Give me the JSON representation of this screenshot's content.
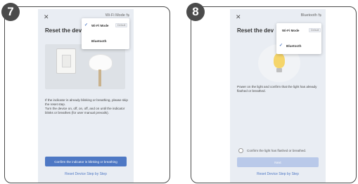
{
  "step_left": {
    "number": "7",
    "close_icon": "close-icon",
    "topright_label": "Wi-Fi Mode ⇆",
    "title": "Reset the dev",
    "dropdown": {
      "items": [
        {
          "label": "Wi-Fi Mode",
          "tag": "Default",
          "selected": true
        },
        {
          "label": "Bluetooth",
          "tag": "",
          "selected": false
        }
      ]
    },
    "description": "If the indicator is already blinking or breathing, please skip the reset step.\nTurn the device on, off, on, off, and on until the indicator blinks or breathes (for user manual prevails).",
    "confirm_button": "Confirm the indicator is blinking or breathing",
    "reset_link": "Reset Device Step by Step"
  },
  "step_right": {
    "number": "8",
    "close_icon": "close-icon",
    "topright_label": "Bluetooth ⇆",
    "title": "Reset the dev",
    "dropdown": {
      "items": [
        {
          "label": "Wi-Fi Mode",
          "tag": "Default",
          "selected": false
        },
        {
          "label": "Bluetooth",
          "tag": "",
          "selected": true
        }
      ]
    },
    "description": "Power on the light and confirm that the light has already flashed or breathed.",
    "radio_label": "Confirm the light has flashed or breathed.",
    "next_button": "Next",
    "reset_link": "Reset Device Step by Step"
  },
  "colors": {
    "accent": "#4e78c4",
    "accent_disabled": "#b9c9e9",
    "phone_bg": "#e9edf3",
    "badge": "#4b4b4b"
  }
}
